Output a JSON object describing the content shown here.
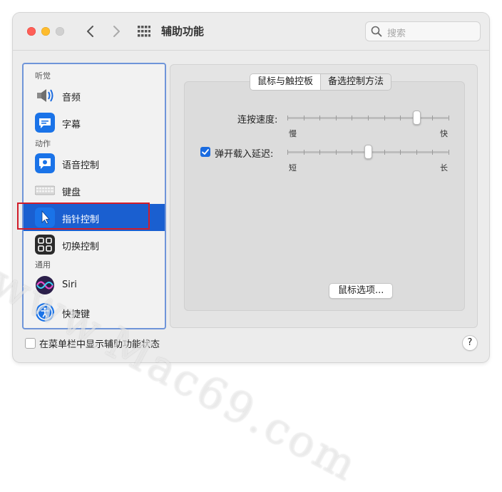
{
  "window": {
    "title": "辅助功能"
  },
  "search": {
    "placeholder": "搜索"
  },
  "sidebar": {
    "sections": [
      {
        "label": "听觉"
      },
      {
        "label": "动作"
      },
      {
        "label": "通用"
      }
    ],
    "items": [
      {
        "label": "音频",
        "icon": "speaker-icon"
      },
      {
        "label": "字幕",
        "icon": "captions-icon"
      },
      {
        "label": "语音控制",
        "icon": "voice-control-icon"
      },
      {
        "label": "键盘",
        "icon": "keyboard-icon"
      },
      {
        "label": "指针控制",
        "icon": "pointer-icon",
        "selected": true
      },
      {
        "label": "切换控制",
        "icon": "switch-control-icon"
      },
      {
        "label": "Siri",
        "icon": "siri-icon"
      },
      {
        "label": "快捷键",
        "icon": "accessibility-icon"
      }
    ]
  },
  "tabs": [
    {
      "label": "鼠标与触控板",
      "active": true
    },
    {
      "label": "备选控制方法",
      "active": false
    }
  ],
  "settings": {
    "double_click": {
      "label": "连按速度:",
      "min_label": "慢",
      "max_label": "快",
      "value_fraction": 0.8
    },
    "spring_loading": {
      "label": "弹开载入延迟:",
      "checked": true,
      "min_label": "短",
      "max_label": "长",
      "value_fraction": 0.5
    }
  },
  "mouse_options_button": "鼠标选项...",
  "footer": {
    "menu_bar_label": "在菜单栏中显示辅助功能状态",
    "menu_bar_checked": false,
    "help_label": "?"
  },
  "watermark": "www.Mac69.com",
  "colors": {
    "accent": "#1a5fd0",
    "highlight_box": "#d11d2a",
    "sidebar_border": "#6f95d9"
  }
}
